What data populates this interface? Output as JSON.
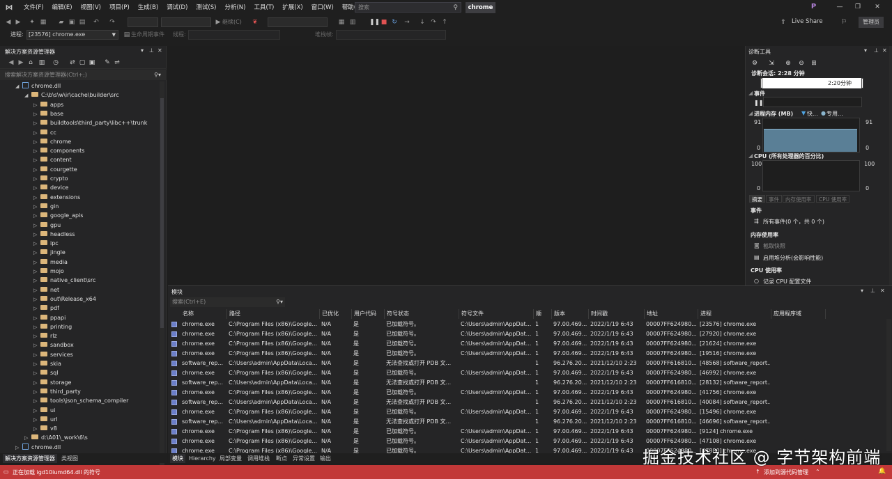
{
  "menu": [
    "文件(F)",
    "编辑(E)",
    "视图(V)",
    "项目(P)",
    "生成(B)",
    "调试(D)",
    "测试(S)",
    "分析(N)",
    "工具(T)",
    "扩展(X)",
    "窗口(W)",
    "帮助(H)"
  ],
  "search_placeholder": "搜索",
  "window_title": "chrome",
  "profile_initial": "P",
  "toolbar": {
    "continue_label": "继续(C)",
    "live_share": "Live Share",
    "admin": "管理员"
  },
  "processbar": {
    "label": "进程:",
    "process": "[23576] chrome.exe",
    "lifecycle": "生命周期事件",
    "thread": "线程:",
    "stackframe": "堆栈帧:"
  },
  "solution_explorer": {
    "title": "解决方案资源管理器",
    "search_placeholder": "搜索解决方案资源管理器(Ctrl+;)",
    "tree": [
      {
        "label": "chrome.dll",
        "kind": "dll",
        "indent": 0,
        "caret": "◢"
      },
      {
        "label": "C:\\b\\s\\w\\ir\\cache\\builder\\src",
        "kind": "folder",
        "indent": 1,
        "caret": "◢"
      },
      {
        "label": "apps",
        "kind": "folder",
        "indent": 2,
        "caret": "▷"
      },
      {
        "label": "base",
        "kind": "folder",
        "indent": 2,
        "caret": "▷"
      },
      {
        "label": "buildtools\\third_party\\libc++\\trunk",
        "kind": "folder",
        "indent": 2,
        "caret": "▷"
      },
      {
        "label": "cc",
        "kind": "folder",
        "indent": 2,
        "caret": "▷"
      },
      {
        "label": "chrome",
        "kind": "folder",
        "indent": 2,
        "caret": "▷"
      },
      {
        "label": "components",
        "kind": "folder",
        "indent": 2,
        "caret": "▷"
      },
      {
        "label": "content",
        "kind": "folder",
        "indent": 2,
        "caret": "▷"
      },
      {
        "label": "courgette",
        "kind": "folder",
        "indent": 2,
        "caret": "▷"
      },
      {
        "label": "crypto",
        "kind": "folder",
        "indent": 2,
        "caret": "▷"
      },
      {
        "label": "device",
        "kind": "folder",
        "indent": 2,
        "caret": "▷"
      },
      {
        "label": "extensions",
        "kind": "folder",
        "indent": 2,
        "caret": "▷"
      },
      {
        "label": "gin",
        "kind": "folder",
        "indent": 2,
        "caret": "▷"
      },
      {
        "label": "google_apis",
        "kind": "folder",
        "indent": 2,
        "caret": "▷"
      },
      {
        "label": "gpu",
        "kind": "folder",
        "indent": 2,
        "caret": "▷"
      },
      {
        "label": "headless",
        "kind": "folder",
        "indent": 2,
        "caret": "▷"
      },
      {
        "label": "ipc",
        "kind": "folder",
        "indent": 2,
        "caret": "▷"
      },
      {
        "label": "jingle",
        "kind": "folder",
        "indent": 2,
        "caret": "▷"
      },
      {
        "label": "media",
        "kind": "folder",
        "indent": 2,
        "caret": "▷"
      },
      {
        "label": "mojo",
        "kind": "folder",
        "indent": 2,
        "caret": "▷"
      },
      {
        "label": "native_client\\src",
        "kind": "folder",
        "indent": 2,
        "caret": "▷"
      },
      {
        "label": "net",
        "kind": "folder",
        "indent": 2,
        "caret": "▷"
      },
      {
        "label": "out\\Release_x64",
        "kind": "folder",
        "indent": 2,
        "caret": "▷"
      },
      {
        "label": "pdf",
        "kind": "folder",
        "indent": 2,
        "caret": "▷"
      },
      {
        "label": "ppapi",
        "kind": "folder",
        "indent": 2,
        "caret": "▷"
      },
      {
        "label": "printing",
        "kind": "folder",
        "indent": 2,
        "caret": "▷"
      },
      {
        "label": "rlz",
        "kind": "folder",
        "indent": 2,
        "caret": "▷"
      },
      {
        "label": "sandbox",
        "kind": "folder",
        "indent": 2,
        "caret": "▷"
      },
      {
        "label": "services",
        "kind": "folder",
        "indent": 2,
        "caret": "▷"
      },
      {
        "label": "skia",
        "kind": "folder",
        "indent": 2,
        "caret": "▷"
      },
      {
        "label": "sql",
        "kind": "folder",
        "indent": 2,
        "caret": "▷"
      },
      {
        "label": "storage",
        "kind": "folder",
        "indent": 2,
        "caret": "▷"
      },
      {
        "label": "third_party",
        "kind": "folder",
        "indent": 2,
        "caret": "▷"
      },
      {
        "label": "tools\\json_schema_compiler",
        "kind": "folder",
        "indent": 2,
        "caret": "▷"
      },
      {
        "label": "ui",
        "kind": "folder",
        "indent": 2,
        "caret": "▷"
      },
      {
        "label": "url",
        "kind": "folder",
        "indent": 2,
        "caret": "▷"
      },
      {
        "label": "v8",
        "kind": "folder",
        "indent": 2,
        "caret": "▷"
      },
      {
        "label": "d:\\A01\\_work\\6\\s",
        "kind": "folder",
        "indent": 1,
        "caret": "▷"
      },
      {
        "label": "chrome.dll",
        "kind": "dll",
        "indent": 0,
        "caret": "▷"
      }
    ],
    "bottom_tabs": [
      "解决方案资源管理器",
      "类视图"
    ]
  },
  "diagnostics": {
    "title": "诊断工具",
    "session": "诊断会话: 2:28 分钟",
    "timeline_label": "2:20分钟",
    "events_heading": "事件",
    "memory_heading": "进程内存 (MB)",
    "memory_legend_fast": "快...",
    "memory_legend_private": "专用...",
    "memory_max": "91",
    "memory_min": "0",
    "memory_usage_fraction": 0.68,
    "cpu_heading": "CPU (所有处理器的百分比)",
    "cpu_max": "100",
    "cpu_min": "0",
    "tabs": [
      "摘要",
      "事件",
      "内存使用率",
      "CPU 使用率"
    ],
    "summary_events": "事件",
    "all_events": "所有事件(0 个，共 0 个)",
    "summary_memory": "内存使用率",
    "take_snapshot": "截取快照",
    "heap_profiling": "启用堆分析(会影响性能)",
    "summary_cpu": "CPU 使用率",
    "record_cpu": "记录 CPU 配置文件"
  },
  "modules": {
    "title": "模块",
    "search_placeholder": "搜索(Ctrl+E)",
    "columns": [
      "名称",
      "路径",
      "已优化",
      "用户代码",
      "符号状态",
      "符号文件",
      "顺",
      "版本",
      "时间戳",
      "地址",
      "进程",
      "应用程序域"
    ],
    "rows": [
      [
        "chrome.exe",
        "C:\\Program Files (x86)\\Google...",
        "N/A",
        "是",
        "已加载符号。",
        "C:\\Users\\admin\\AppDat...",
        "1",
        "97.00.469...",
        "2022/1/19 6:43",
        "00007FF624980...",
        "[23576] chrome.exe",
        ""
      ],
      [
        "chrome.exe",
        "C:\\Program Files (x86)\\Google...",
        "N/A",
        "是",
        "已加载符号。",
        "C:\\Users\\admin\\AppDat...",
        "1",
        "97.00.469...",
        "2022/1/19 6:43",
        "00007FF624980...",
        "[27920] chrome.exe",
        ""
      ],
      [
        "chrome.exe",
        "C:\\Program Files (x86)\\Google...",
        "N/A",
        "是",
        "已加载符号。",
        "C:\\Users\\admin\\AppDat...",
        "1",
        "97.00.469...",
        "2022/1/19 6:43",
        "00007FF624980...",
        "[21624] chrome.exe",
        ""
      ],
      [
        "chrome.exe",
        "C:\\Program Files (x86)\\Google...",
        "N/A",
        "是",
        "已加载符号。",
        "C:\\Users\\admin\\AppDat...",
        "1",
        "97.00.469...",
        "2022/1/19 6:43",
        "00007FF624980...",
        "[19516] chrome.exe",
        ""
      ],
      [
        "software_rep...",
        "C:\\Users\\admin\\AppData\\Loca...",
        "N/A",
        "是",
        "无法查找或打开 PDB 文...",
        "",
        "1",
        "96.276.20...",
        "2021/12/10 2:23",
        "00007FF616810...",
        "[48568] software_report...",
        ""
      ],
      [
        "chrome.exe",
        "C:\\Program Files (x86)\\Google...",
        "N/A",
        "是",
        "已加载符号。",
        "C:\\Users\\admin\\AppDat...",
        "1",
        "97.00.469...",
        "2022/1/19 6:43",
        "00007FF624980...",
        "[46992] chrome.exe",
        ""
      ],
      [
        "software_rep...",
        "C:\\Users\\admin\\AppData\\Loca...",
        "N/A",
        "是",
        "无法查找或打开 PDB 文...",
        "",
        "1",
        "96.276.20...",
        "2021/12/10 2:23",
        "00007FF616810...",
        "[28132] software_report...",
        ""
      ],
      [
        "chrome.exe",
        "C:\\Program Files (x86)\\Google...",
        "N/A",
        "是",
        "已加载符号。",
        "C:\\Users\\admin\\AppDat...",
        "1",
        "97.00.469...",
        "2022/1/19 6:43",
        "00007FF624980...",
        "[41756] chrome.exe",
        ""
      ],
      [
        "software_rep...",
        "C:\\Users\\admin\\AppData\\Loca...",
        "N/A",
        "是",
        "无法查找或打开 PDB 文...",
        "",
        "1",
        "96.276.20...",
        "2021/12/10 2:23",
        "00007FF616810...",
        "[40084] software_report...",
        ""
      ],
      [
        "chrome.exe",
        "C:\\Program Files (x86)\\Google...",
        "N/A",
        "是",
        "已加载符号。",
        "C:\\Users\\admin\\AppDat...",
        "1",
        "97.00.469...",
        "2022/1/19 6:43",
        "00007FF624980...",
        "[15496] chrome.exe",
        ""
      ],
      [
        "software_rep...",
        "C:\\Users\\admin\\AppData\\Loca...",
        "N/A",
        "是",
        "无法查找或打开 PDB 文...",
        "",
        "1",
        "96.276.20...",
        "2021/12/10 2:23",
        "00007FF616810...",
        "[46696] software_report...",
        ""
      ],
      [
        "chrome.exe",
        "C:\\Program Files (x86)\\Google...",
        "N/A",
        "是",
        "已加载符号。",
        "C:\\Users\\admin\\AppDat...",
        "1",
        "97.00.469...",
        "2022/1/19 6:43",
        "00007FF624980...",
        "[9124] chrome.exe",
        ""
      ],
      [
        "chrome.exe",
        "C:\\Program Files (x86)\\Google...",
        "N/A",
        "是",
        "已加载符号。",
        "C:\\Users\\admin\\AppDat...",
        "1",
        "97.00.469...",
        "2022/1/19 6:43",
        "00007FF624980...",
        "[47108] chrome.exe",
        ""
      ],
      [
        "chrome.exe",
        "C:\\Program Files (x86)\\Google...",
        "N/A",
        "是",
        "已加载符号。",
        "C:\\Users\\admin\\AppDat...",
        "1",
        "97.00.469...",
        "2022/1/19 6:43",
        "00007FF624980...",
        "[47880] chrome.exe",
        ""
      ]
    ],
    "bottom_tabs": [
      "模块",
      "Hierarchy",
      "局部变量",
      "调用堆栈",
      "断点",
      "异常设置",
      "输出"
    ]
  },
  "status": {
    "text": "正在加载 igd10iumd64.dll 的符号",
    "source_control": "添加到源代码管理"
  },
  "watermark": "掘金技术社区 @ 字节架构前端",
  "colors": {
    "statusbar": "#c23838",
    "memory_fill": "#5a7f96",
    "module_icon": "#6c7fc9"
  }
}
